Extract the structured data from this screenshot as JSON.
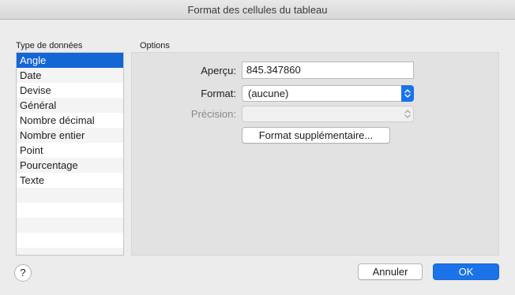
{
  "window": {
    "title": "Format des cellules du tableau"
  },
  "type_section": {
    "heading": "Type de données",
    "items": [
      "Angle",
      "Date",
      "Devise",
      "Général",
      "Nombre décimal",
      "Nombre entier",
      "Point",
      "Pourcentage",
      "Texte"
    ],
    "selected": "Angle"
  },
  "options": {
    "heading": "Options",
    "preview_label": "Aperçu:",
    "preview_value": "845.347860",
    "format_label": "Format:",
    "format_value": "(aucune)",
    "precision_label": "Précision:",
    "precision_value": "",
    "extra_format_button": "Format supplémentaire..."
  },
  "footer": {
    "help_label": "?",
    "cancel_label": "Annuler",
    "ok_label": "OK"
  },
  "colors": {
    "accent": "#1a73e8",
    "selection": "#1466d6",
    "window_bg": "#ececec"
  },
  "icons": {
    "popup_arrows": "updown-chevron-icon",
    "help": "help-icon"
  }
}
